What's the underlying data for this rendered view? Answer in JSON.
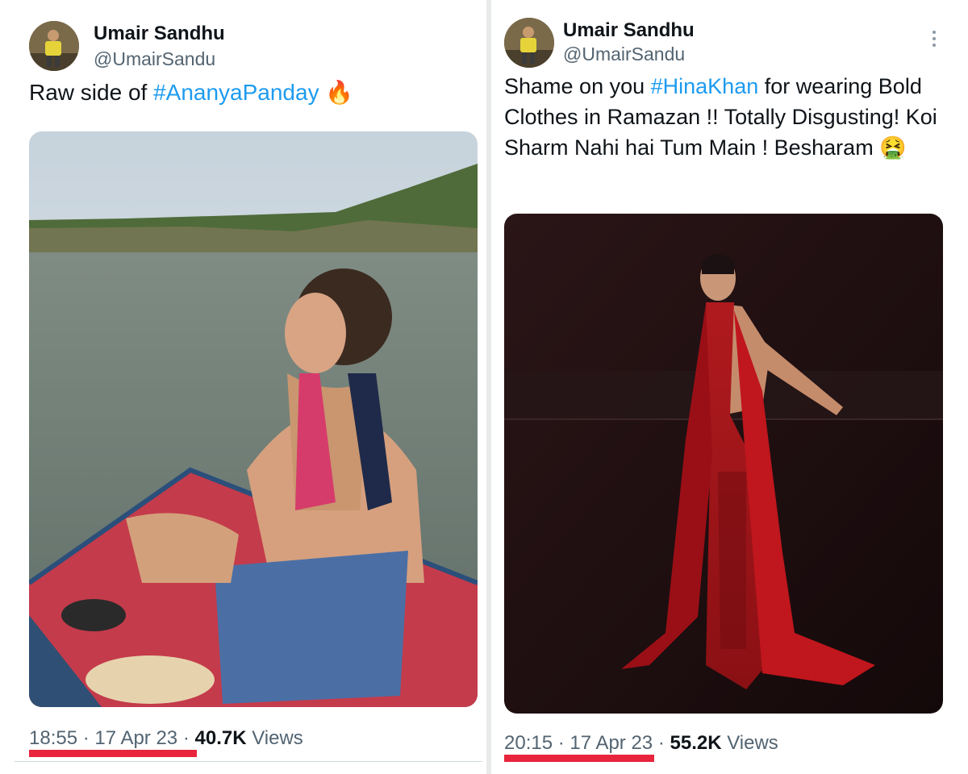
{
  "tweets": [
    {
      "author_name": "Umair Sandhu",
      "author_handle": "@UmairSandu",
      "text_before": "Raw side of ",
      "hashtag": "#AnanyaPanday",
      "text_after": " 🔥",
      "time": "18:55",
      "date": "17 Apr 23",
      "views_count": "40.7K",
      "views_label": "Views",
      "separator": "·"
    },
    {
      "author_name": "Umair Sandhu",
      "author_handle": "@UmairSandu",
      "text_before": "Shame on you ",
      "hashtag": "#HinaKhan",
      "text_after": " for wearing Bold Clothes in Ramazan !! Totally Disgusting! Koi Sharm Nahi hai Tum Main ! Besharam 🤮",
      "time": "20:15",
      "date": "17 Apr 23",
      "views_count": "55.2K",
      "views_label": "Views",
      "separator": "·"
    }
  ],
  "colors": {
    "hashtag": "#1d9bf0",
    "underline": "#e8243d",
    "secondary_text": "#536471"
  },
  "icons": [
    "more-vertical-icon"
  ]
}
